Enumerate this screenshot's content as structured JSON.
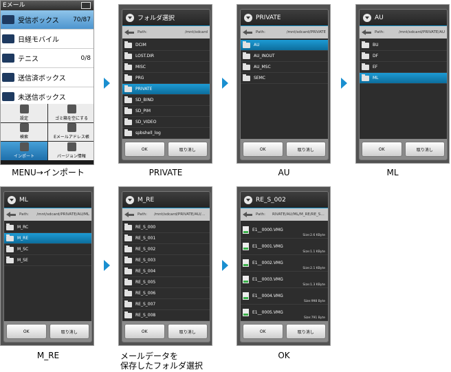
{
  "app": {
    "title": "Eメール",
    "folders": [
      {
        "name": "受信ボックス",
        "count": "70/87"
      },
      {
        "name": "日経モバイル",
        "count": ""
      },
      {
        "name": "テニス",
        "count": "0/8"
      },
      {
        "name": "送信済ボックス",
        "count": ""
      },
      {
        "name": "未送信ボックス",
        "count": ""
      }
    ],
    "menu": [
      "設定",
      "ゴミ箱を空にする",
      "検索",
      "Eメールアドレス帳",
      "インポート",
      "バージョン情報"
    ]
  },
  "screens": [
    {
      "title": "フォルダ選択",
      "path_label": "Path:",
      "path": "/mnt/sdcard",
      "items": [
        "DCIM",
        "LOST.DIR",
        "MISC",
        "PRG",
        "PRIVATE",
        "SD_BIND",
        "SD_PIM",
        "SD_VIDEO",
        "spbshell_log"
      ],
      "selected": 4
    },
    {
      "title": "PRIVATE",
      "path_label": "Path:",
      "path": "/mnt/sdcard/PRIVATE",
      "items": [
        "AU",
        "AU_INOUT",
        "AU_MSC",
        "SEMC"
      ],
      "selected": 0
    },
    {
      "title": "AU",
      "path_label": "Path:",
      "path": "/mnt/sdcard/PRIVATE/AU",
      "items": [
        "BU",
        "DF",
        "EF",
        "ML"
      ],
      "selected": 3
    },
    {
      "title": "ML",
      "path_label": "Path:",
      "path": "/mnt/sdcard/PRIVATE/AU/ML",
      "items": [
        "M_RC",
        "M_RE",
        "M_SC",
        "M_SE"
      ],
      "selected": 1
    },
    {
      "title": "M_RE",
      "path_label": "Path:",
      "path": "/mnt/sdcard/PRIVATE/AU/ML/M_RE",
      "items": [
        "RE_S_000",
        "RE_S_001",
        "RE_S_002",
        "RE_S_003",
        "RE_S_004",
        "RE_S_005",
        "RE_S_006",
        "RE_S_007",
        "RE_S_008"
      ],
      "selected": -1
    },
    {
      "title": "RE_S_002",
      "path_label": "Path:",
      "path": "RIVATE/AU/ML/M_RE/RE_S_002",
      "files": [
        {
          "name": "E1__0000.VMG",
          "size": "Size:2.6 KByte"
        },
        {
          "name": "E1__0001.VMG",
          "size": "Size:1.1 KByte"
        },
        {
          "name": "E1__0002.VMG",
          "size": "Size:2.1 KByte"
        },
        {
          "name": "E1__0003.VMG",
          "size": "Size:1.3 KByte"
        },
        {
          "name": "E1__0004.VMG",
          "size": "Size:998 Byte"
        },
        {
          "name": "E1__0005.VMG",
          "size": "Size:791 Byte"
        }
      ]
    }
  ],
  "buttons": {
    "ok": "OK",
    "cancel": "取り消し"
  },
  "captions": [
    "MENU→インポート",
    "PRIVATE",
    "AU",
    "ML",
    "M_RE",
    "メールデータを",
    "保存したフォルダ選択",
    "OK"
  ],
  "colors": {
    "accent": "#1a8fd0",
    "selection": "#1d9ad4"
  }
}
